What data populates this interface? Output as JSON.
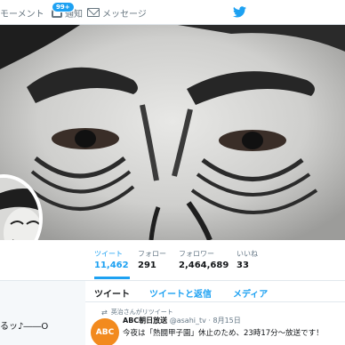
{
  "nav": {
    "moments": "モーメント",
    "notifications": "通知",
    "notification_badge": "99+",
    "messages": "メッセージ"
  },
  "stats": [
    {
      "label": "ツイート",
      "value": "11,462",
      "active": true
    },
    {
      "label": "フォロー",
      "value": "291"
    },
    {
      "label": "フォロワー",
      "value": "2,464,689"
    },
    {
      "label": "いいね",
      "value": "33"
    }
  ],
  "bio": {
    "snippet": "るッ♪――O"
  },
  "timeline": {
    "tabs": [
      "ツイート",
      "ツイートと返信",
      "メディア"
    ],
    "retweet_note": "英治さんがリツイート",
    "tweet": {
      "avatar_text": "ABC",
      "name": "ABC朝日放送",
      "handle": "@asahi_tv · 8月15日",
      "text": "今夜は「熱闘甲子園」休止のため、23時17分～放送です！"
    }
  },
  "colors": {
    "accent": "#1da1f2",
    "tweet_avatar": "#f28a1e"
  },
  "icons": [
    "moments-icon",
    "bell-icon",
    "envelope-icon",
    "twitter-bird-icon",
    "retweet-icon"
  ]
}
